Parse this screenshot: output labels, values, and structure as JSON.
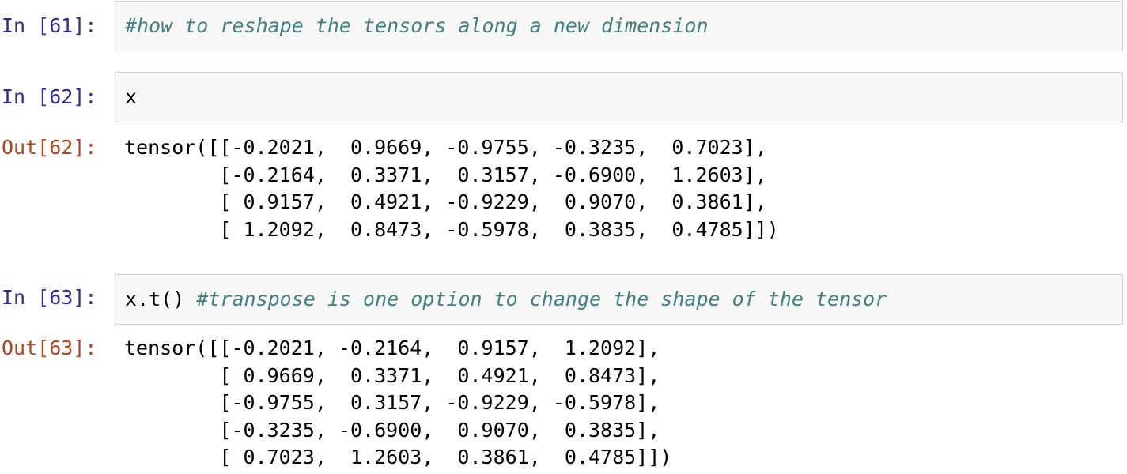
{
  "cells": [
    {
      "prompt": "In [61]:",
      "code": "",
      "comment": "#how to reshape the tensors along a new dimension"
    },
    {
      "prompt": "In [62]:",
      "code": "x",
      "comment": "",
      "output_prompt": "Out[62]:",
      "output": "tensor([[-0.2021,  0.9669, -0.9755, -0.3235,  0.7023],\n        [-0.2164,  0.3371,  0.3157, -0.6900,  1.2603],\n        [ 0.9157,  0.4921, -0.9229,  0.9070,  0.3861],\n        [ 1.2092,  0.8473, -0.5978,  0.3835,  0.4785]])"
    },
    {
      "prompt": "In [63]:",
      "code": "x.t() ",
      "comment": "#transpose is one option to change the shape of the tensor",
      "output_prompt": "Out[63]:",
      "output": "tensor([[-0.2021, -0.2164,  0.9157,  1.2092],\n        [ 0.9669,  0.3371,  0.4921,  0.8473],\n        [-0.9755,  0.3157, -0.9229, -0.5978],\n        [-0.3235, -0.6900,  0.9070,  0.3835],\n        [ 0.7023,  1.2603,  0.3861,  0.4785]])"
    }
  ]
}
